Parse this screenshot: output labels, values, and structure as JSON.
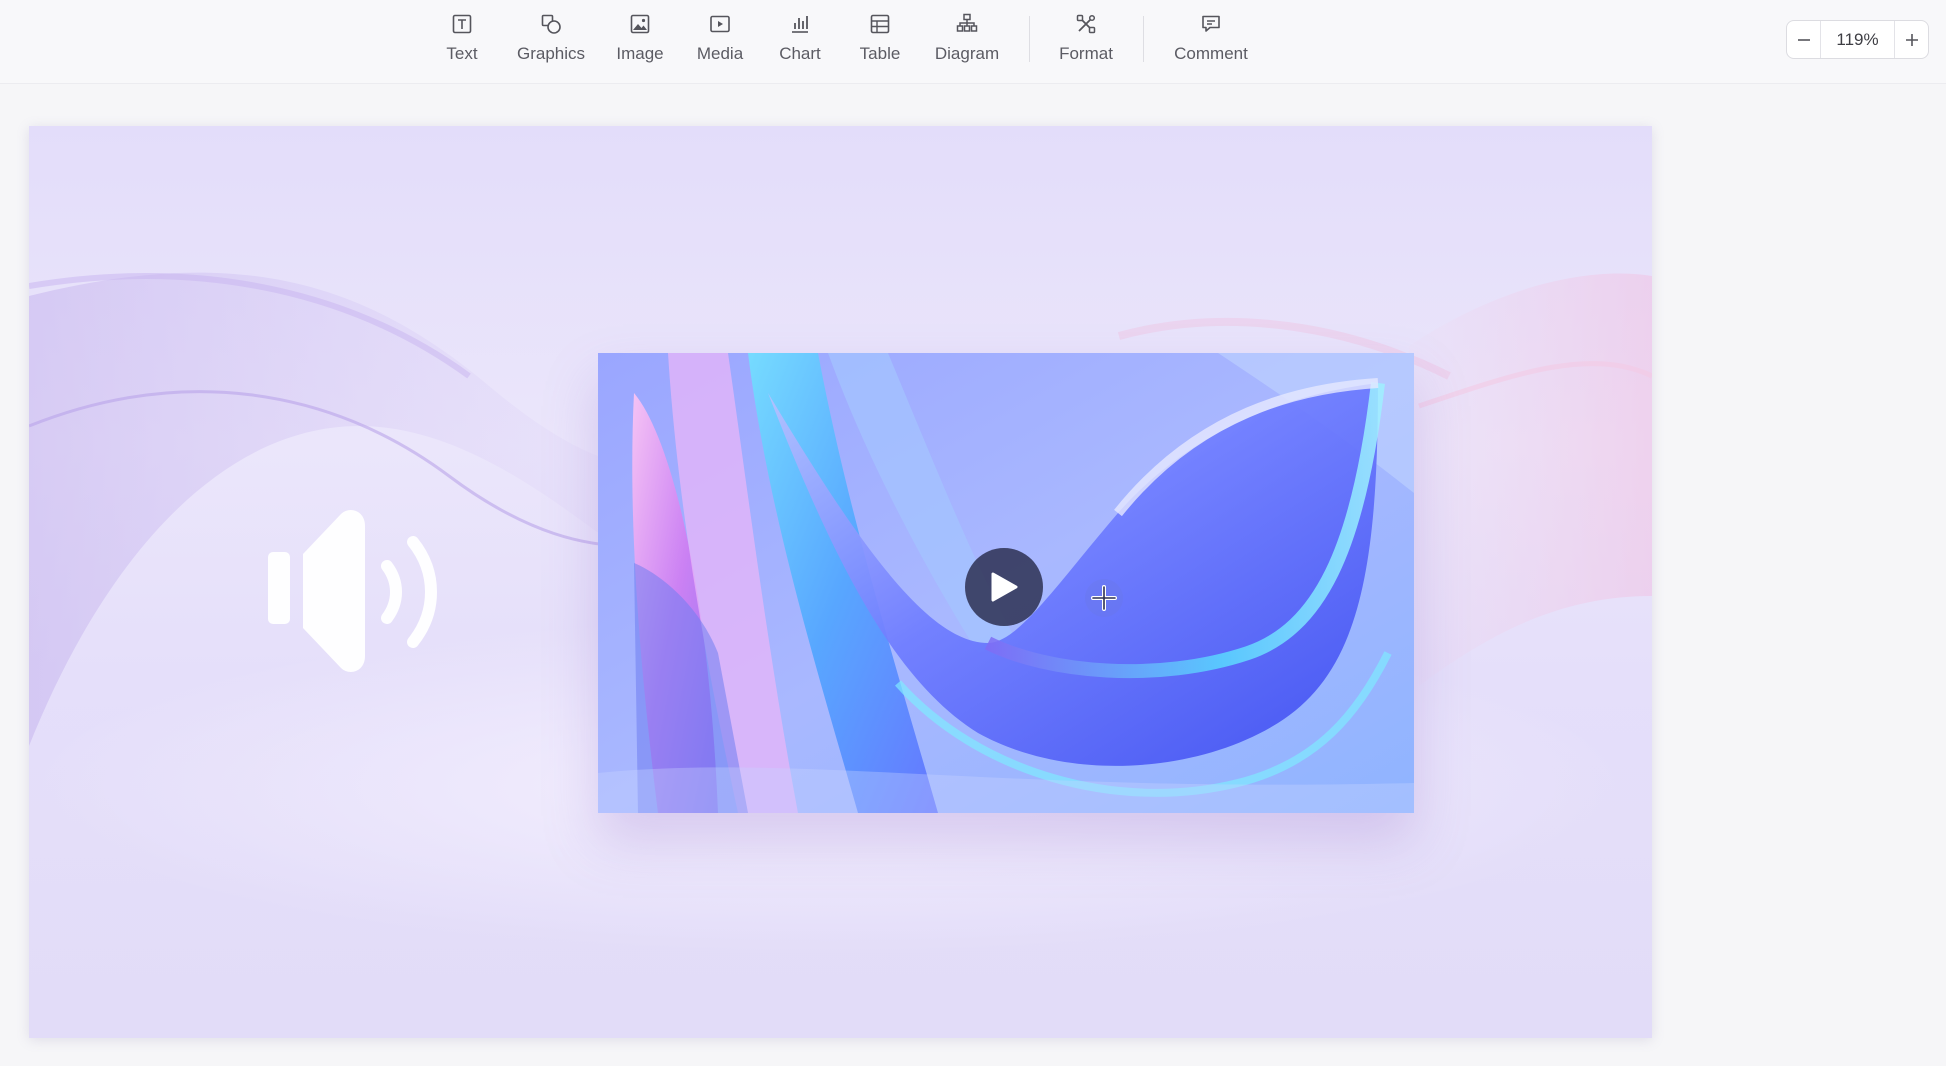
{
  "toolbar": {
    "tools": [
      {
        "label": "Text",
        "icon": "text-box-icon"
      },
      {
        "label": "Graphics",
        "icon": "shapes-icon"
      },
      {
        "label": "Image",
        "icon": "image-icon"
      },
      {
        "label": "Media",
        "icon": "media-play-icon"
      },
      {
        "label": "Chart",
        "icon": "bar-chart-icon"
      },
      {
        "label": "Table",
        "icon": "table-icon"
      },
      {
        "label": "Diagram",
        "icon": "diagram-icon"
      },
      {
        "label": "Format",
        "icon": "format-tools-icon"
      },
      {
        "label": "Comment",
        "icon": "comment-icon"
      }
    ]
  },
  "zoom": {
    "value": "119%",
    "decrease_icon": "minus-icon",
    "increase_icon": "plus-icon"
  },
  "slide": {
    "audio_icon": "speaker-volume-icon",
    "video": {
      "play_icon": "play-icon",
      "cursor_icon": "move-cursor-icon"
    },
    "colors": {
      "background": "#e6e0fa",
      "play_button": "#2d3052"
    }
  }
}
